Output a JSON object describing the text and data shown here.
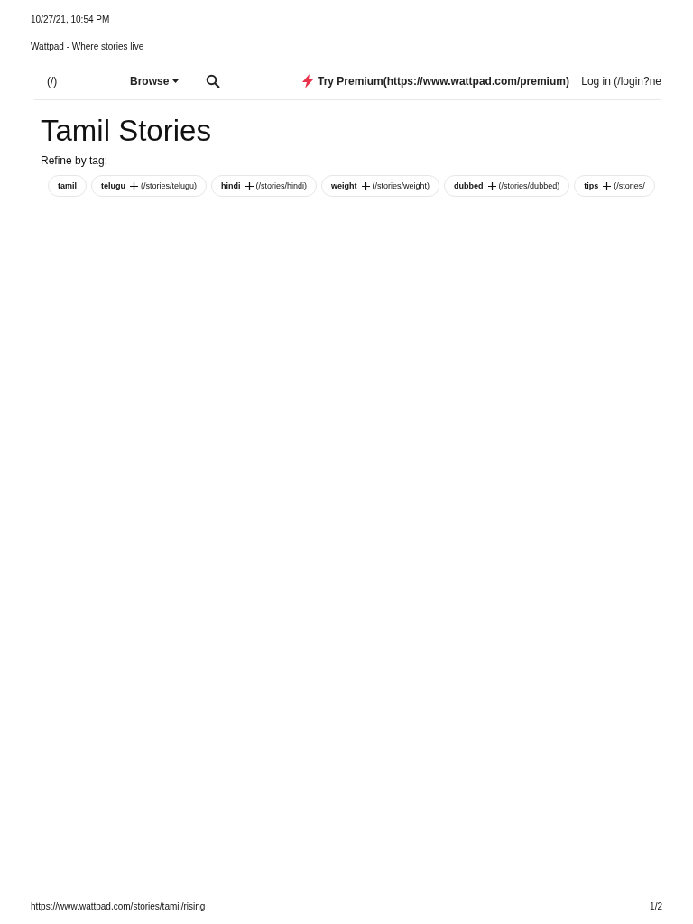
{
  "print_header": {
    "date": "10/27/21, 10:54 PM",
    "title": "Wattpad - Where stories live"
  },
  "nav": {
    "home_link": "(/)",
    "browse": "Browse",
    "premium": "Try Premium(https://www.wattpad.com/premium)",
    "login": "Log in (/login?ne"
  },
  "page": {
    "title": "Tamil Stories",
    "refine_label": "Refine by tag:"
  },
  "tags": [
    {
      "label": "tamil"
    },
    {
      "label": "telugu",
      "link": "(/stories/telugu)"
    },
    {
      "label": "hindi",
      "link": "(/stories/hindi)"
    },
    {
      "label": "weight",
      "link": "(/stories/weight)"
    },
    {
      "label": "dubbed",
      "link": "(/stories/dubbed)"
    },
    {
      "label": "tips",
      "link": "(/stories/"
    }
  ],
  "print_footer": {
    "url": "https://www.wattpad.com/stories/tamil/rising",
    "page": "1/2"
  }
}
